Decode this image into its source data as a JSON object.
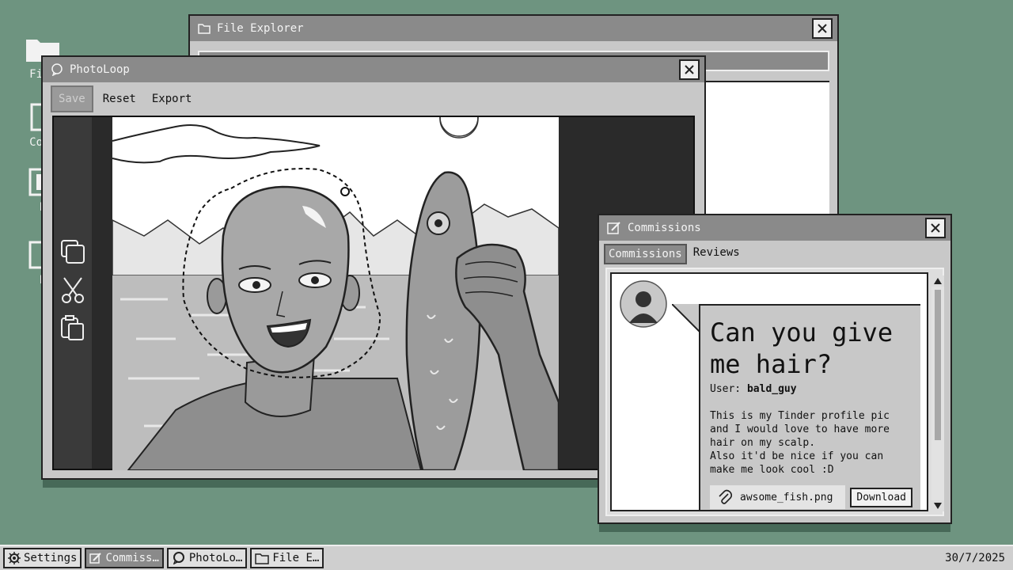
{
  "desktop": {
    "icons": [
      {
        "label": "File",
        "icon": "folder-icon"
      },
      {
        "label": "Comm",
        "icon": "document-icon"
      },
      {
        "label": "E",
        "icon": "image-icon"
      },
      {
        "label": "E",
        "icon": "document-icon"
      }
    ]
  },
  "file_explorer": {
    "title": "File Explorer"
  },
  "photoloop": {
    "title": "PhotoLoop",
    "toolbar": {
      "save": "Save",
      "reset": "Reset",
      "export": "Export"
    },
    "tools": [
      "copy-icon",
      "scissors-icon",
      "paste-icon"
    ]
  },
  "commissions": {
    "title": "Commissions",
    "tabs": {
      "commissions": "Commissions",
      "reviews": "Reviews"
    },
    "request": {
      "title": "Can you give me hair?",
      "user_label": "User:",
      "user_name": "bald_guy",
      "description": "This is my Tinder profile pic and I would love to have more hair on my scalp.\nAlso it'd be nice if you can make me look cool :D",
      "attachment": "awsome_fish.png",
      "download": "Download"
    }
  },
  "taskbar": {
    "items": [
      {
        "label": "Settings",
        "icon": "gear-icon"
      },
      {
        "label": "Commiss…",
        "icon": "edit-icon"
      },
      {
        "label": "PhotoLo…",
        "icon": "chat-icon"
      },
      {
        "label": "File E…",
        "icon": "folder-icon"
      }
    ],
    "clock": "30/7/2025"
  }
}
